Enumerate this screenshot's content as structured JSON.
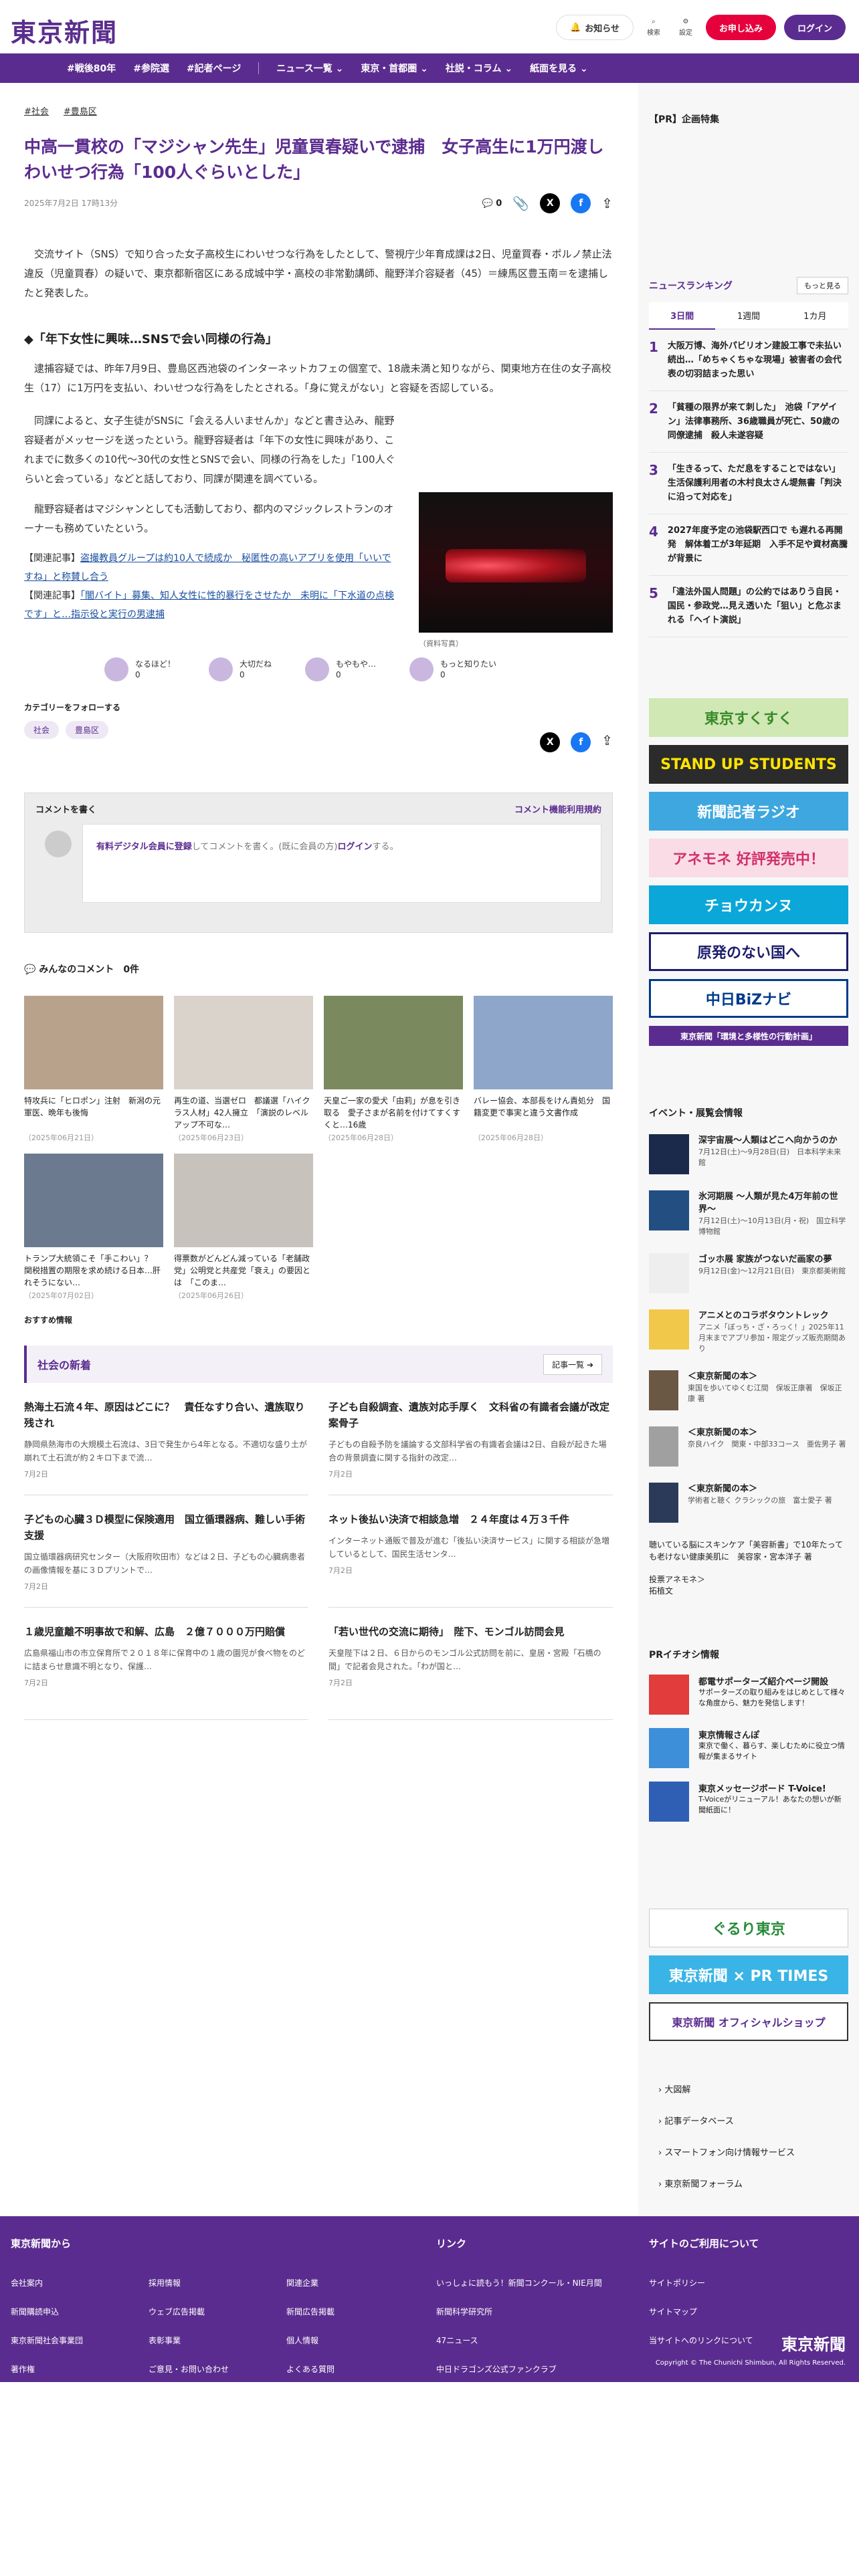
{
  "header": {
    "logo": "東京新聞",
    "notice": "お知らせ",
    "search": "検索",
    "settings": "設定",
    "apply": "お申し込み",
    "login": "ログイン"
  },
  "nav": [
    "#戦後80年",
    "#参院選",
    "#記者ページ",
    "ニュース一覧 ⌄",
    "東京・首都圏 ⌄",
    "社説・コラム ⌄",
    "紙面を見る ⌄"
  ],
  "article": {
    "tags": [
      "#社会",
      "#豊島区"
    ],
    "title": "中高一貫校の「マジシャン先生」児童買春疑いで逮捕　女子高生に1万円渡しわいせつ行為「100人ぐらいとした」",
    "date": "2025年7月2日 17時13分",
    "comment_count": "0",
    "lead": "交流サイト（SNS）で知り合った女子高校生にわいせつな行為をしたとして、警視庁少年育成課は2日、児童買春・ポルノ禁止法違反（児童買春）の疑いで、東京都新宿区にある成城中学・高校の非常勤講師、龍野洋介容疑者（45）＝練馬区豊玉南＝を逮捕したと発表した。",
    "subhead": "◆「年下女性に興味…SNSで会い同様の行為」",
    "p1": "逮捕容疑では、昨年7月9日、豊島区西池袋のインターネットカフェの個室で、18歳未満と知りながら、関東地方在住の女子高校生（17）に1万円を支払い、わいせつな行為をしたとされる。「身に覚えがない」と容疑を否認している。",
    "p2": "同課によると、女子生徒がSNSに「会える人いませんか」などと書き込み、龍野容疑者がメッセージを送ったという。龍野容疑者は「年下の女性に興味があり、これまでに数多くの10代〜30代の女性とSNSで会い、同様の行為をした」「100人ぐらいと会っている」などと話しており、同課が関連を調べている。",
    "p3": "龍野容疑者はマジシャンとしても活動しており、都内のマジックレストランのオーナーも務めていたという。",
    "caption": "（資料写真）",
    "related1_label": "【関連記事】",
    "related1": "盗撮教員グループは約10人で続成か　秘匿性の高いアプリを使用「いいですね」と称賛し合う",
    "related2_label": "【関連記事】",
    "related2": "「闇バイト」募集、知人女性に性的暴行をさせたか　未明に「下水道の点検です」と…指示役と実行の男逮捕"
  },
  "reactions": [
    {
      "label": "なるほど！",
      "count": "0"
    },
    {
      "label": "大切だね",
      "count": "0"
    },
    {
      "label": "もやもや…",
      "count": "0"
    },
    {
      "label": "もっと知りたい",
      "count": "0"
    }
  ],
  "follow": {
    "title": "カテゴリーをフォローする",
    "tags": [
      "社会",
      "豊島区"
    ]
  },
  "comments": {
    "write": "コメントを書く",
    "rules": "コメント機能利用規約",
    "prompt_member": "有料デジタル会員に登録",
    "prompt_mid": "してコメントを書く。(既に会員の方)",
    "prompt_login": "ログイン",
    "prompt_end": "する。",
    "all_label": "みんなのコメント",
    "all_count": "0件"
  },
  "cards": [
    {
      "title": "特攻兵に「ヒロポン」注射　新潟の元軍医、晩年も後悔",
      "date": "（2025年06月21日）",
      "color": "#b9a28c"
    },
    {
      "title": "再生の道、当選ゼロ　都議選「ハイクラス人材」42人擁立　「演説のレベルアップ不可な…",
      "date": "（2025年06月23日）",
      "color": "#d9d3cc"
    },
    {
      "title": "天皇ご一家の愛犬「由莉」が息を引き取る　愛子さまが名前を付けてすくすくと…16歳",
      "date": "（2025年06月28日）",
      "color": "#7b8a5e"
    },
    {
      "title": "バレー協会、本部長をけん責処分　国籍変更で事実と違う文書作成",
      "date": "（2025年06月28日）",
      "color": "#8da6c9"
    },
    {
      "title": "トランプ大統領こそ「手こわい」？　関税措置の期限を求め続ける日本…肝れそうにない…",
      "date": "（2025年07月02日）",
      "color": "#6c7a90"
    },
    {
      "title": "得票数がどんどん減っている「老舗政党」公明党と共産党「衰え」の要因とは　「このま…",
      "date": "（2025年06月26日）",
      "color": "#c8c2bc"
    }
  ],
  "recommend_label": "おすすめ情報",
  "section": {
    "title": "社会の新着",
    "more": "記事一覧 ➔"
  },
  "news": [
    {
      "title": "熱海土石流４年、原因はどこに？　責任なすり合い、遺族取り残され",
      "body": "静岡県熱海市の大規模土石流は、3日で発生から4年となる。不適切な盛り土が崩れて土石流が約２キロ下まで流…",
      "date": "7月2日"
    },
    {
      "title": "子ども自殺調査、遺族対応手厚く　文科省の有識者会議が改定案骨子",
      "body": "子どもの自殺予防を議論する文部科学省の有識者会議は2日、自殺が起きた場合の背景調査に関する指針の改定…",
      "date": "7月2日"
    },
    {
      "title": "子どもの心臓３Ｄ模型に保険適用　国立循環器病、難しい手術支援",
      "body": "国立循環器病研究センター（大阪府吹田市）などは２日、子どもの心臓病患者の画像情報を基に３Ｄプリントで…",
      "date": "7月2日"
    },
    {
      "title": "ネット後払い決済で相談急増　２４年度は４万３千件",
      "body": "インターネット通販で普及が進む「後払い決済サービス」に関する相談が急増しているとして、国民生活センタ…",
      "date": "7月2日"
    },
    {
      "title": "１歳児童離不明事故で和解、広島　２億７０００万円賠償",
      "body": "広島県福山市の市立保育所で２０１８年に保育中の１歳の園児が食べ物をのどに詰まらせ意識不明となり、保護…",
      "date": "7月2日"
    },
    {
      "title": "「若い世代の交流に期待」　陛下、モンゴル訪問会見",
      "body": "天皇陛下は２日、６日からのモンゴル公式訪問を前に、皇居・宮殿「石橋の間」で記者会見された。「わが国と…",
      "date": "7月2日"
    }
  ],
  "sidebar": {
    "pr_label": "【PR】企画特集",
    "ranking_label": "ニュースランキング",
    "ranking_more": "もっと見る",
    "tabs": [
      "3日間",
      "1週間",
      "1カ月"
    ],
    "ranking": [
      "大阪万博、海外パビリオン建設工事で未払い続出…「めちゃくちゃな現場」被害者の会代表の切羽詰まった思い",
      "「貧種の限界が来て刺した」　池袋「アゲイン」法律事務所、36歳職員が死亡、50歳の同僚逮捕　殺人未遂容疑",
      "「生きるって、ただ息をすることではない」生活保護利用者の木村良太さん堤無書「判決に沿って対応を」",
      "2027年度予定の池袋駅西口で も遅れる再開発　解体着工が3年延期　入手不足や資材高騰が背景に",
      "「違法外国人問題」の公約ではありう自民・国民・参政党…見え透いた「狙い」と危ぶまれる「ヘイト演説」"
    ],
    "banners": [
      {
        "label": "東京すくすく",
        "bg": "#cfe8b4",
        "fg": "#3a8a2a"
      },
      {
        "label": "STAND UP STUDENTS",
        "bg": "#2b2b2b",
        "fg": "#ffe400"
      },
      {
        "label": "新聞記者ラジオ",
        "bg": "#3fa7e0",
        "fg": "#ffffff"
      },
      {
        "label": "アネモネ 好評発売中！",
        "bg": "#f9dce6",
        "fg": "#d0306a"
      },
      {
        "label": "チョウカンヌ",
        "bg": "#0aa7d8",
        "fg": "#ffffff"
      },
      {
        "label": "原発のない国へ",
        "bg": "#ffffff",
        "fg": "#1d1d6b"
      },
      {
        "label": "中日BiZナビ",
        "bg": "#ffffff",
        "fg": "#003a8c"
      },
      {
        "label": "東京新聞「環境と多様性の行動計画」",
        "bg": "#5b2c8f",
        "fg": "#ffffff"
      }
    ],
    "events_label": "イベント・展覧会情報",
    "events": [
      {
        "title": "深宇宙展〜人類はどこへ向かうのか",
        "body": "7月12日(土)〜9月28日(日)　日本科学未来館",
        "color": "#1b2a4a"
      },
      {
        "title": "氷河期展 〜人類が見た4万年前の世界〜",
        "body": "7月12日(土)〜10月13日(月・祝)　国立科学博物館",
        "color": "#224e82"
      },
      {
        "title": "ゴッホ展 家族がつないだ画家の夢",
        "body": "9月12日(金)〜12月21日(日)　東京都美術館",
        "color": "#eeeeee"
      },
      {
        "title": "アニメとのコラボタウントレック",
        "body": "アニメ「ぼっち・ざ・ろっく！」2025年11月末までアプリ参加・限定グッズ販売期間あり",
        "color": "#f2c84a"
      },
      {
        "title": "＜東京新聞の本＞",
        "body": "東国を歩いてゆくむ江間　保坂正康著　保坂正康 著",
        "color": "#6b5844"
      },
      {
        "title": "＜東京新聞の本＞",
        "body": "奈良ハイク　関東・中部33コース　亜佐男子 著",
        "color": "#a0a0a0"
      },
      {
        "title": "＜東京新聞の本＞",
        "body": "学術者と聴く クラシックの旅　富士愛子 著",
        "color": "#2c3a5a"
      }
    ],
    "ev_text": "聴いている脳にスキンケア「美容新書」で10年たっても老けない健康美肌に　美容家・宮本洋子 著",
    "ev_link": "投票アネモネ＞",
    "ev_link2": "拓植文",
    "pr_info_label": "PRイチオシ情報",
    "pr_info": [
      {
        "title": "都電サポーターズ紹介ページ開設",
        "body": "サポーターズの取り組みをはじめとして様々な角度から、魅力を発信します！",
        "color": "#e23c3c"
      },
      {
        "title": "東京情報さんぽ",
        "body": "東京で働く、暮らす、楽しむために役立つ情報が集まるサイト",
        "color": "#3c8fd8"
      },
      {
        "title": "東京メッセージボード T-Voice!",
        "body": "T-Voiceがリニューアル！あなたの想いが新聞紙面に！",
        "color": "#2f5fb5"
      }
    ],
    "banners2": [
      {
        "label": "ぐるり東京",
        "bg": "#ffffff",
        "fg": "#2a8a3a"
      },
      {
        "label": "東京新聞 × PR TIMES",
        "bg": "#3ab4e6",
        "fg": "#ffffff"
      },
      {
        "label": "東京新聞 オフィシャルショップ",
        "bg": "#ffffff",
        "fg": "#5b2c8f"
      }
    ],
    "links": [
      "大図解",
      "記事データベース",
      "スマートフォン向け情報サービス",
      "東京新聞フォーラム"
    ]
  },
  "footer": {
    "col1_title": "東京新聞から",
    "col1": [
      [
        "会社案内",
        "採用情報",
        "関連企業"
      ],
      [
        "新聞購読申込",
        "ウェブ広告掲載",
        "新聞広告掲載"
      ],
      [
        "東京新聞社会事業団",
        "表彰事業",
        "個人情報"
      ],
      [
        "著作権",
        "ご意見・お問い合わせ",
        "よくある質問"
      ]
    ],
    "col2_title": "リンク",
    "col2": [
      "いっしょに読もう！新聞コンクール・NIE月間",
      "新聞科学研究所",
      "47ニュース",
      "中日ドラゴンズ公式ファンクラブ"
    ],
    "col3_title": "サイトのご利用について",
    "col3": [
      "サイトポリシー",
      "サイトマップ",
      "当サイトへのリンクについて"
    ],
    "logo": "東京新聞",
    "copyright": "Copyright © The Chunichi Shimbun, All Rights Reserved."
  }
}
